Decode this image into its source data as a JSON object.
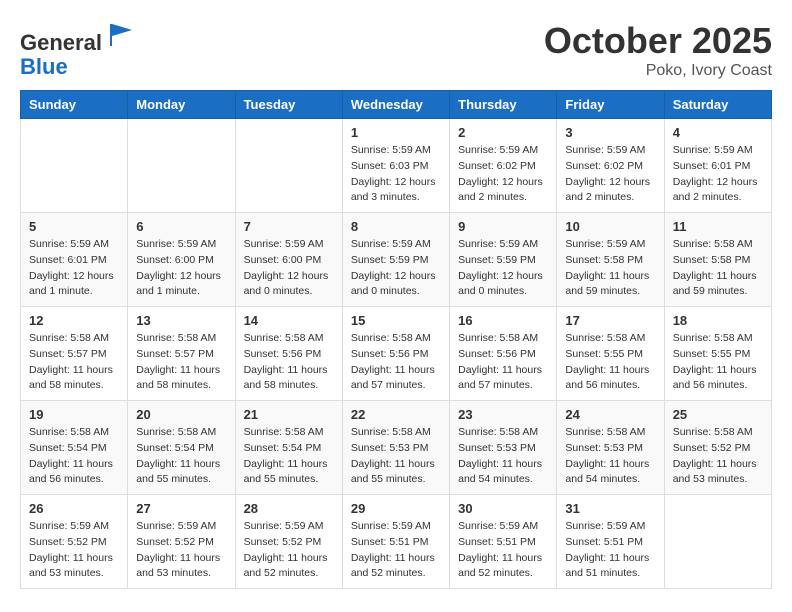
{
  "header": {
    "logo_line1": "General",
    "logo_line2": "Blue",
    "month": "October 2025",
    "location": "Poko, Ivory Coast"
  },
  "weekdays": [
    "Sunday",
    "Monday",
    "Tuesday",
    "Wednesday",
    "Thursday",
    "Friday",
    "Saturday"
  ],
  "weeks": [
    [
      {
        "day": "",
        "info": ""
      },
      {
        "day": "",
        "info": ""
      },
      {
        "day": "",
        "info": ""
      },
      {
        "day": "1",
        "info": "Sunrise: 5:59 AM\nSunset: 6:03 PM\nDaylight: 12 hours\nand 3 minutes."
      },
      {
        "day": "2",
        "info": "Sunrise: 5:59 AM\nSunset: 6:02 PM\nDaylight: 12 hours\nand 2 minutes."
      },
      {
        "day": "3",
        "info": "Sunrise: 5:59 AM\nSunset: 6:02 PM\nDaylight: 12 hours\nand 2 minutes."
      },
      {
        "day": "4",
        "info": "Sunrise: 5:59 AM\nSunset: 6:01 PM\nDaylight: 12 hours\nand 2 minutes."
      }
    ],
    [
      {
        "day": "5",
        "info": "Sunrise: 5:59 AM\nSunset: 6:01 PM\nDaylight: 12 hours\nand 1 minute."
      },
      {
        "day": "6",
        "info": "Sunrise: 5:59 AM\nSunset: 6:00 PM\nDaylight: 12 hours\nand 1 minute."
      },
      {
        "day": "7",
        "info": "Sunrise: 5:59 AM\nSunset: 6:00 PM\nDaylight: 12 hours\nand 0 minutes."
      },
      {
        "day": "8",
        "info": "Sunrise: 5:59 AM\nSunset: 5:59 PM\nDaylight: 12 hours\nand 0 minutes."
      },
      {
        "day": "9",
        "info": "Sunrise: 5:59 AM\nSunset: 5:59 PM\nDaylight: 12 hours\nand 0 minutes."
      },
      {
        "day": "10",
        "info": "Sunrise: 5:59 AM\nSunset: 5:58 PM\nDaylight: 11 hours\nand 59 minutes."
      },
      {
        "day": "11",
        "info": "Sunrise: 5:58 AM\nSunset: 5:58 PM\nDaylight: 11 hours\nand 59 minutes."
      }
    ],
    [
      {
        "day": "12",
        "info": "Sunrise: 5:58 AM\nSunset: 5:57 PM\nDaylight: 11 hours\nand 58 minutes."
      },
      {
        "day": "13",
        "info": "Sunrise: 5:58 AM\nSunset: 5:57 PM\nDaylight: 11 hours\nand 58 minutes."
      },
      {
        "day": "14",
        "info": "Sunrise: 5:58 AM\nSunset: 5:56 PM\nDaylight: 11 hours\nand 58 minutes."
      },
      {
        "day": "15",
        "info": "Sunrise: 5:58 AM\nSunset: 5:56 PM\nDaylight: 11 hours\nand 57 minutes."
      },
      {
        "day": "16",
        "info": "Sunrise: 5:58 AM\nSunset: 5:56 PM\nDaylight: 11 hours\nand 57 minutes."
      },
      {
        "day": "17",
        "info": "Sunrise: 5:58 AM\nSunset: 5:55 PM\nDaylight: 11 hours\nand 56 minutes."
      },
      {
        "day": "18",
        "info": "Sunrise: 5:58 AM\nSunset: 5:55 PM\nDaylight: 11 hours\nand 56 minutes."
      }
    ],
    [
      {
        "day": "19",
        "info": "Sunrise: 5:58 AM\nSunset: 5:54 PM\nDaylight: 11 hours\nand 56 minutes."
      },
      {
        "day": "20",
        "info": "Sunrise: 5:58 AM\nSunset: 5:54 PM\nDaylight: 11 hours\nand 55 minutes."
      },
      {
        "day": "21",
        "info": "Sunrise: 5:58 AM\nSunset: 5:54 PM\nDaylight: 11 hours\nand 55 minutes."
      },
      {
        "day": "22",
        "info": "Sunrise: 5:58 AM\nSunset: 5:53 PM\nDaylight: 11 hours\nand 55 minutes."
      },
      {
        "day": "23",
        "info": "Sunrise: 5:58 AM\nSunset: 5:53 PM\nDaylight: 11 hours\nand 54 minutes."
      },
      {
        "day": "24",
        "info": "Sunrise: 5:58 AM\nSunset: 5:53 PM\nDaylight: 11 hours\nand 54 minutes."
      },
      {
        "day": "25",
        "info": "Sunrise: 5:58 AM\nSunset: 5:52 PM\nDaylight: 11 hours\nand 53 minutes."
      }
    ],
    [
      {
        "day": "26",
        "info": "Sunrise: 5:59 AM\nSunset: 5:52 PM\nDaylight: 11 hours\nand 53 minutes."
      },
      {
        "day": "27",
        "info": "Sunrise: 5:59 AM\nSunset: 5:52 PM\nDaylight: 11 hours\nand 53 minutes."
      },
      {
        "day": "28",
        "info": "Sunrise: 5:59 AM\nSunset: 5:52 PM\nDaylight: 11 hours\nand 52 minutes."
      },
      {
        "day": "29",
        "info": "Sunrise: 5:59 AM\nSunset: 5:51 PM\nDaylight: 11 hours\nand 52 minutes."
      },
      {
        "day": "30",
        "info": "Sunrise: 5:59 AM\nSunset: 5:51 PM\nDaylight: 11 hours\nand 52 minutes."
      },
      {
        "day": "31",
        "info": "Sunrise: 5:59 AM\nSunset: 5:51 PM\nDaylight: 11 hours\nand 51 minutes."
      },
      {
        "day": "",
        "info": ""
      }
    ]
  ]
}
